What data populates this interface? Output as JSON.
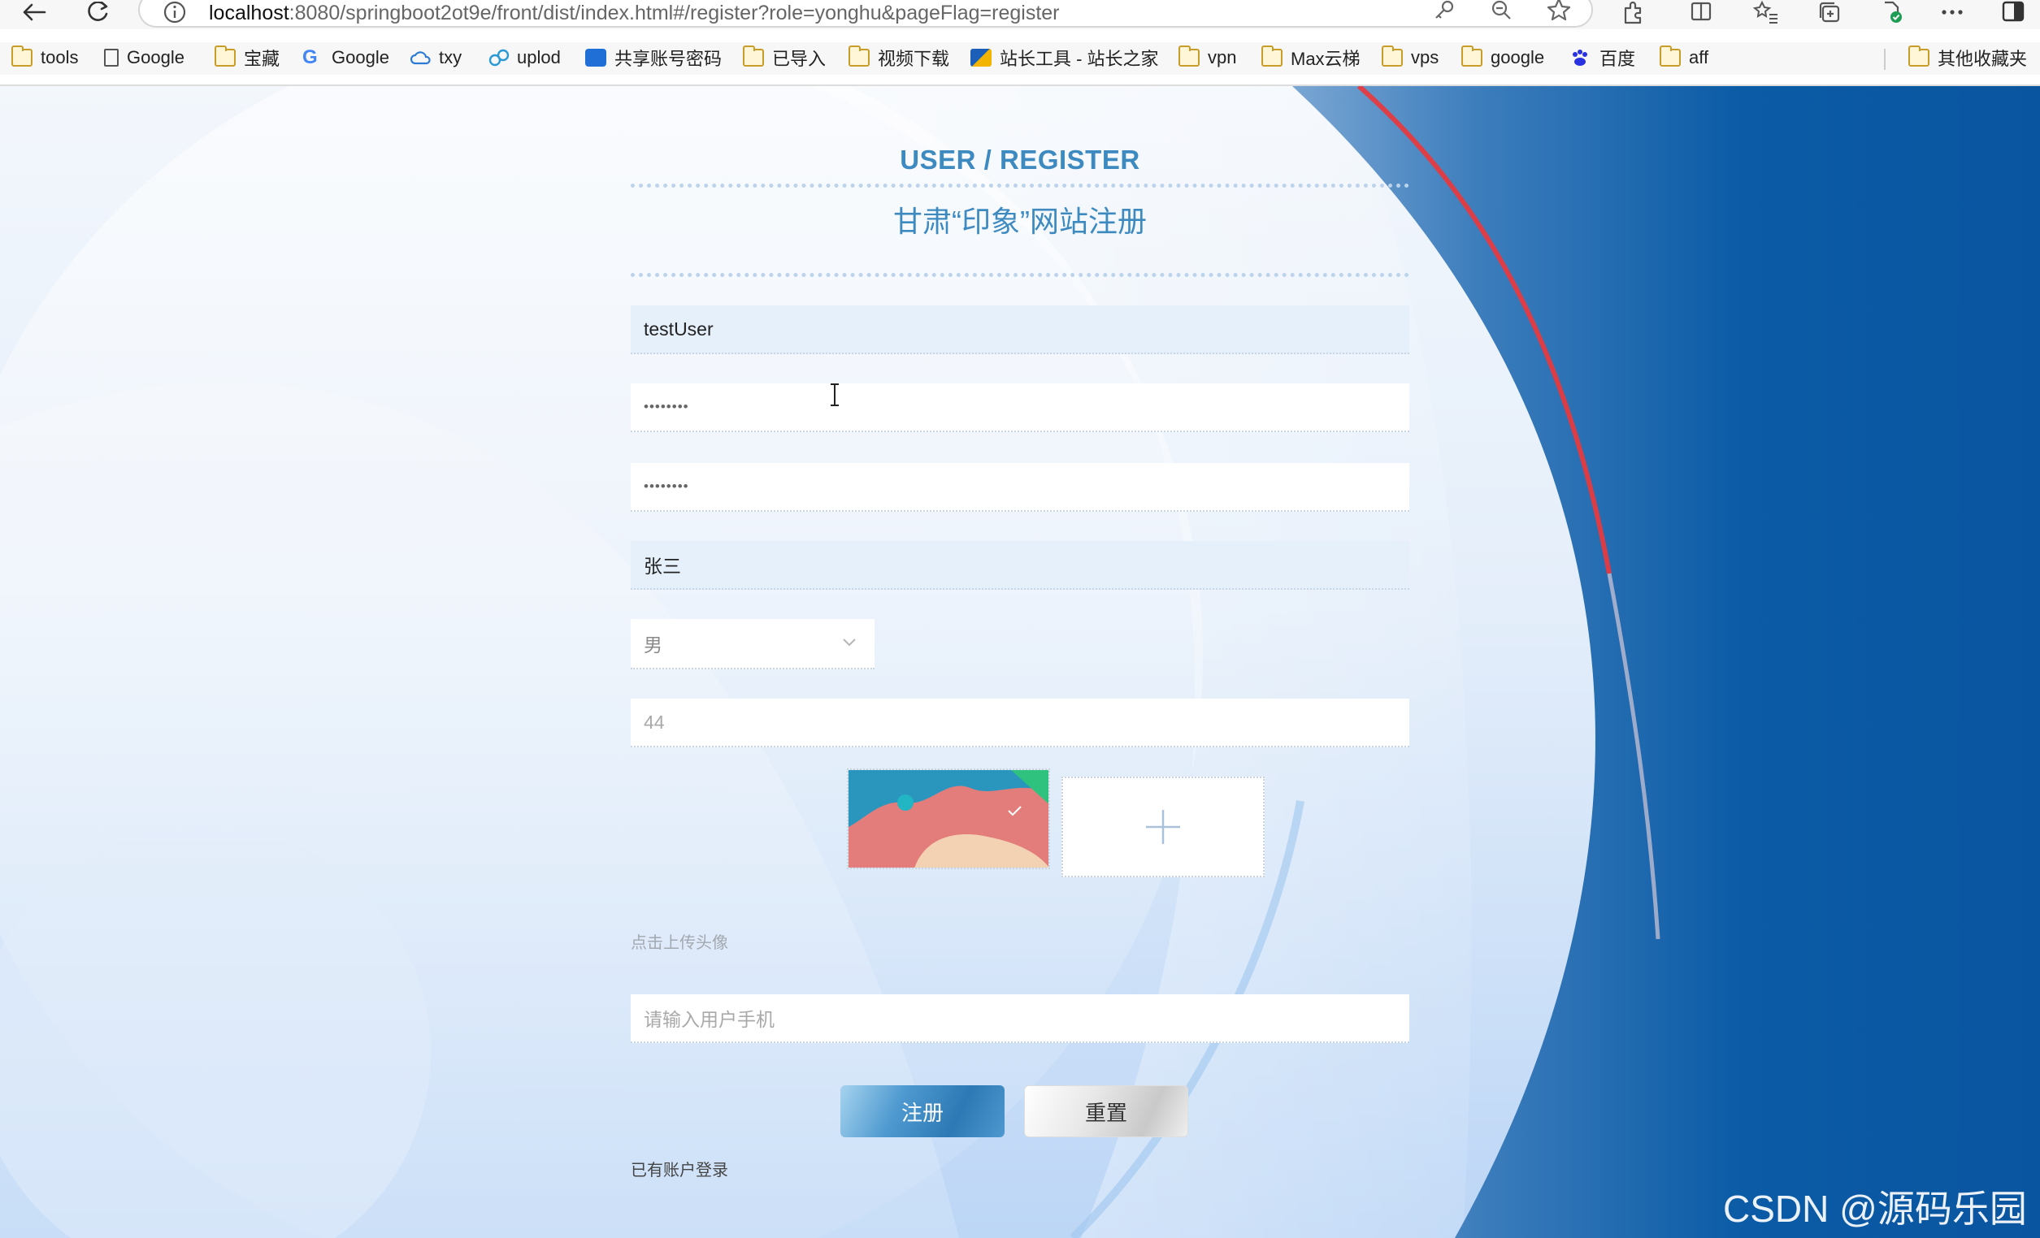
{
  "browser": {
    "url_host": "localhost",
    "url_path": ":8080/springboot2ot9e/front/dist/index.html#/register?role=yonghu&pageFlag=register",
    "bookmarks": [
      {
        "label": "tools",
        "icon": "folder-icon"
      },
      {
        "label": "Google",
        "icon": "page-icon"
      },
      {
        "label": "宝藏",
        "icon": "folder-icon"
      },
      {
        "label": "Google",
        "icon": "google-icon"
      },
      {
        "label": "txy",
        "icon": "cloud-icon"
      },
      {
        "label": "uplod",
        "icon": "link-icon"
      },
      {
        "label": "共享账号密码",
        "icon": "app-icon"
      },
      {
        "label": "已导入",
        "icon": "folder-icon"
      },
      {
        "label": "视频下载",
        "icon": "folder-icon"
      },
      {
        "label": "站长工具 - 站长之家",
        "icon": "site-icon"
      },
      {
        "label": "vpn",
        "icon": "folder-icon"
      },
      {
        "label": "Max云梯",
        "icon": "folder-icon"
      },
      {
        "label": "vps",
        "icon": "folder-icon"
      },
      {
        "label": "google",
        "icon": "folder-icon"
      },
      {
        "label": "百度",
        "icon": "baidu-icon"
      },
      {
        "label": "aff",
        "icon": "folder-icon"
      }
    ],
    "other_bookmarks": "其他收藏夹"
  },
  "form": {
    "title": "USER / REGISTER",
    "subtitle": "甘肃“印象”网站注册",
    "username": "testUser",
    "password_mask": "••••••••",
    "confirm_mask": "••••••••",
    "name": "张三",
    "gender": "男",
    "age": "44",
    "upload_hint": "点击上传头像",
    "phone_placeholder": "请输入用户手机",
    "register_button": "注册",
    "reset_button": "重置",
    "login_link": "已有账户登录"
  },
  "watermark": "CSDN @源码乐园",
  "colors": {
    "accent": "#3d8ac1",
    "panel_blue": "#0a5ba4",
    "red_stripe": "#e63a3f"
  }
}
